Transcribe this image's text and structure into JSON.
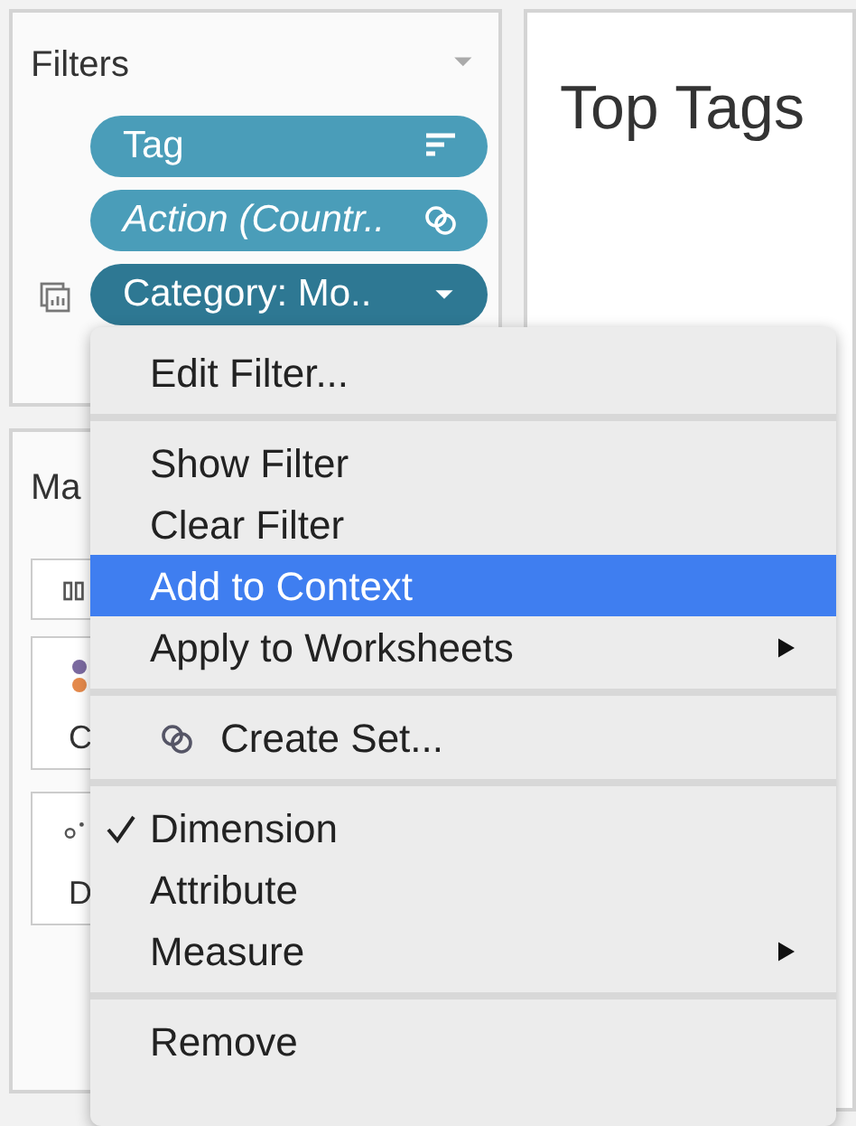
{
  "filters": {
    "title": "Filters",
    "pills": [
      {
        "label": "Tag",
        "kind": "sort",
        "selected": false,
        "italic": false
      },
      {
        "label": "Action (Countr..",
        "kind": "set",
        "selected": false,
        "italic": true
      },
      {
        "label": "Category: Mo..",
        "kind": "menu",
        "selected": true,
        "italic": false
      }
    ]
  },
  "marks": {
    "title": "Ma",
    "tiles": [
      {
        "label": "C",
        "kind": "color"
      },
      {
        "label": "D",
        "kind": "detail"
      }
    ]
  },
  "sheet": {
    "title": "Top Tags"
  },
  "menu": {
    "groups": [
      [
        {
          "label": "Edit Filter...",
          "kind": "plain",
          "selected": false,
          "checked": false,
          "submenu": false
        }
      ],
      [
        {
          "label": "Show Filter",
          "kind": "plain",
          "selected": false,
          "checked": false,
          "submenu": false
        },
        {
          "label": "Clear Filter",
          "kind": "plain",
          "selected": false,
          "checked": false,
          "submenu": false
        },
        {
          "label": "Add to Context",
          "kind": "plain",
          "selected": true,
          "checked": false,
          "submenu": false
        },
        {
          "label": "Apply to Worksheets",
          "kind": "plain",
          "selected": false,
          "checked": false,
          "submenu": true
        }
      ],
      [
        {
          "label": "Create Set...",
          "kind": "set",
          "selected": false,
          "checked": false,
          "submenu": false
        }
      ],
      [
        {
          "label": "Dimension",
          "kind": "plain",
          "selected": false,
          "checked": true,
          "submenu": false
        },
        {
          "label": "Attribute",
          "kind": "plain",
          "selected": false,
          "checked": false,
          "submenu": false
        },
        {
          "label": "Measure",
          "kind": "plain",
          "selected": false,
          "checked": false,
          "submenu": true
        }
      ],
      [
        {
          "label": "Remove",
          "kind": "plain",
          "selected": false,
          "checked": false,
          "submenu": false
        }
      ]
    ]
  }
}
